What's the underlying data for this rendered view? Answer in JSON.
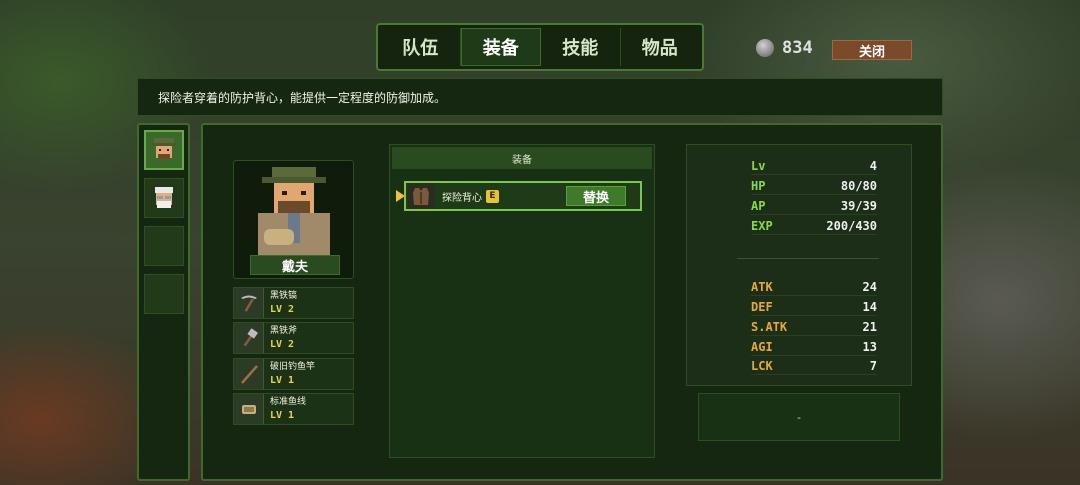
{
  "tabs": [
    {
      "label": "队伍",
      "active": false
    },
    {
      "label": "装备",
      "active": true
    },
    {
      "label": "技能",
      "active": false
    },
    {
      "label": "物品",
      "active": false
    }
  ],
  "currency": {
    "value": "834",
    "icon": "silver-coin-icon"
  },
  "close_label": "关闭",
  "description": "探险者穿着的防护背心，能提供一定程度的防御加成。",
  "character": {
    "name": "戴夫"
  },
  "tools": [
    {
      "name": "黑铁镐",
      "level": "LV 2",
      "icon": "pickaxe-icon"
    },
    {
      "name": "黑铁斧",
      "level": "LV 2",
      "icon": "axe-icon"
    },
    {
      "name": "破旧钓鱼竿",
      "level": "LV 1",
      "icon": "fishing-rod-icon"
    },
    {
      "name": "标准鱼线",
      "level": "LV 1",
      "icon": "fishing-line-icon"
    }
  ],
  "equipment": {
    "header": "装备",
    "item_name": "探险背心",
    "item_badge": "E",
    "replace_label": "替换"
  },
  "stats_primary": [
    {
      "key": "Lv",
      "value": "4"
    },
    {
      "key": "HP",
      "value": "80/80"
    },
    {
      "key": "AP",
      "value": "39/39"
    },
    {
      "key": "EXP",
      "value": "200/430"
    }
  ],
  "stats_secondary": [
    {
      "key": "ATK",
      "value": "24"
    },
    {
      "key": "DEF",
      "value": "14"
    },
    {
      "key": "S.ATK",
      "value": "21"
    },
    {
      "key": "AGI",
      "value": "13"
    },
    {
      "key": "LCK",
      "value": "7"
    }
  ],
  "info_box": "-",
  "colors": {
    "accent_green": "#7ac850",
    "stat_primary": "#8ad84a",
    "stat_secondary": "#e6a83a",
    "badge": "#e6c43a"
  }
}
